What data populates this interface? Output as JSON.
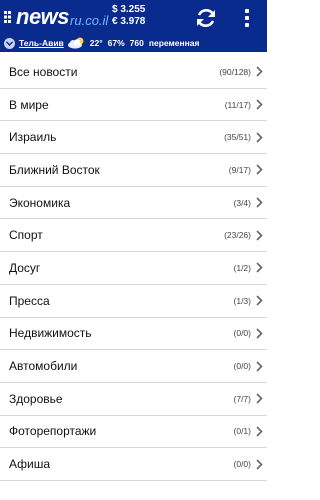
{
  "header": {
    "logo": {
      "brand": "news",
      "domain": "ru.co.il"
    },
    "rates": [
      {
        "symbol": "$",
        "value": "3.255"
      },
      {
        "symbol": "€",
        "value": "3.978"
      }
    ],
    "buttons": {
      "refresh_icon": "refresh-icon",
      "menu_icon": "overflow-menu-icon"
    },
    "colors": {
      "header_bg": "#0a2b8e",
      "domain": "#6fb8ff"
    }
  },
  "weather": {
    "city": "Тель-Авив",
    "icon": "cloud-sun-icon",
    "temperature": "22°",
    "humidity": "67%",
    "pressure": "760",
    "condition": "переменная"
  },
  "categories": [
    {
      "label": "Все новости",
      "count": "(90/128)"
    },
    {
      "label": "В мире",
      "count": "(11/17)"
    },
    {
      "label": "Израиль",
      "count": "(35/51)"
    },
    {
      "label": "Ближний Восток",
      "count": "(9/17)"
    },
    {
      "label": "Экономика",
      "count": "(3/4)"
    },
    {
      "label": "Спорт",
      "count": "(23/26)"
    },
    {
      "label": "Досуг",
      "count": "(1/2)"
    },
    {
      "label": "Пресса",
      "count": "(1/3)"
    },
    {
      "label": "Недвижимость",
      "count": "(0/0)"
    },
    {
      "label": "Автомобили",
      "count": "(0/0)"
    },
    {
      "label": "Здоровье",
      "count": "(7/7)"
    },
    {
      "label": "Фоторепортажи",
      "count": "(0/1)"
    },
    {
      "label": "Афиша",
      "count": "(0/0)"
    }
  ]
}
